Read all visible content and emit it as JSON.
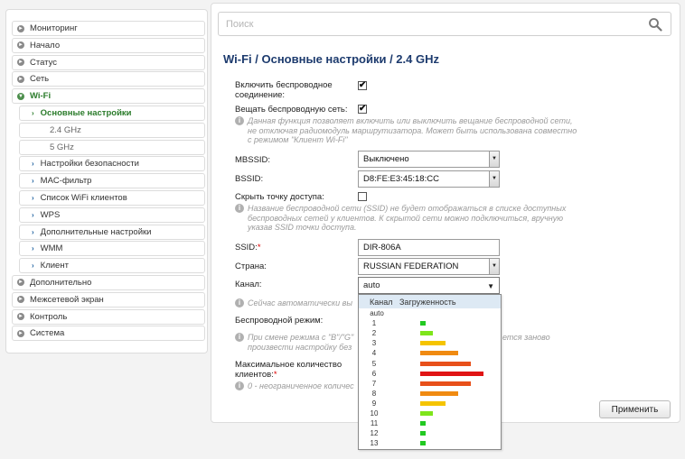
{
  "sidebar": {
    "items": [
      {
        "label": "Мониторинг",
        "kind": "top"
      },
      {
        "label": "Начало",
        "kind": "top"
      },
      {
        "label": "Статус",
        "kind": "top"
      },
      {
        "label": "Сеть",
        "kind": "top"
      },
      {
        "label": "Wi-Fi",
        "kind": "open"
      },
      {
        "label": "Основные настройки",
        "kind": "sub-active"
      },
      {
        "label": "2.4 GHz",
        "kind": "subsub"
      },
      {
        "label": "5 GHz",
        "kind": "subsub"
      },
      {
        "label": "Настройки безопасности",
        "kind": "sub"
      },
      {
        "label": "MAC-фильтр",
        "kind": "sub"
      },
      {
        "label": "Список WiFi клиентов",
        "kind": "sub"
      },
      {
        "label": "WPS",
        "kind": "sub"
      },
      {
        "label": "Дополнительные настройки",
        "kind": "sub"
      },
      {
        "label": "WMM",
        "kind": "sub"
      },
      {
        "label": "Клиент",
        "kind": "sub"
      },
      {
        "label": "Дополнительно",
        "kind": "top"
      },
      {
        "label": "Межсетевой экран",
        "kind": "top"
      },
      {
        "label": "Контроль",
        "kind": "top"
      },
      {
        "label": "Система",
        "kind": "top"
      }
    ]
  },
  "search": {
    "placeholder": "Поиск"
  },
  "page": {
    "title": "Wi-Fi /  Основные настройки /  2.4 GHz"
  },
  "form": {
    "enable_label": "Включить беспроводное соединение:",
    "enable_checked": true,
    "broadcast_label": "Вещать беспроводную сеть:",
    "broadcast_checked": true,
    "broadcast_hint": "Данная функция позволяет включить или выключить вещание беспроводной сети, не отключая радиомодуль маршрутизатора. Может быть использована совместно с режимом \"Клиент Wi-Fi\"",
    "mbssid_label": "MBSSID:",
    "mbssid_value": "Выключено",
    "bssid_label": "BSSID:",
    "bssid_value": "D8:FE:E3:45:18:CC",
    "hide_label": "Скрыть точку доступа:",
    "hide_checked": false,
    "hide_hint": "Название беспроводной сети (SSID) не будет отображаться в списке доступных беспроводных сетей у клиентов. К скрытой сети можно подключиться, вручную указав SSID точки доступа.",
    "ssid_label": "SSID:",
    "ssid_required": "*",
    "ssid_value": "DIR-806A",
    "country_label": "Страна:",
    "country_value": "RUSSIAN FEDERATION",
    "channel_label": "Канал:",
    "channel_value": "auto",
    "channel_hint": "Сейчас автоматически вы",
    "mode_label": "Беспроводной режим:",
    "mode_hint_left": "При смене режима с \"B\"/\"G\"",
    "mode_hint_left2": "произвести настройку без",
    "mode_hint_right": "ется заново",
    "max_clients_label": "Максимальное количество клиентов:",
    "max_clients_required": "*",
    "max_clients_hint": "0 - неограниченное количес",
    "apply_label": "Применить"
  },
  "channel_dropdown": {
    "col_channel": "Канал",
    "col_load": "Загруженность",
    "rows": [
      {
        "channel": "auto",
        "load": 0,
        "color": ""
      },
      {
        "channel": "1",
        "load": 0.08,
        "color": "#22c922"
      },
      {
        "channel": "2",
        "load": 0.2,
        "color": "#7ee51b"
      },
      {
        "channel": "3",
        "load": 0.4,
        "color": "#f5c400"
      },
      {
        "channel": "4",
        "load": 0.6,
        "color": "#f08a11"
      },
      {
        "channel": "5",
        "load": 0.8,
        "color": "#e8501a"
      },
      {
        "channel": "6",
        "load": 1.0,
        "color": "#e01414"
      },
      {
        "channel": "7",
        "load": 0.8,
        "color": "#e8501a"
      },
      {
        "channel": "8",
        "load": 0.6,
        "color": "#f08a11"
      },
      {
        "channel": "9",
        "load": 0.4,
        "color": "#f5c400"
      },
      {
        "channel": "10",
        "load": 0.2,
        "color": "#7ee51b"
      },
      {
        "channel": "11",
        "load": 0.08,
        "color": "#22c922"
      },
      {
        "channel": "12",
        "load": 0.08,
        "color": "#22c922"
      },
      {
        "channel": "13",
        "load": 0.08,
        "color": "#22c922"
      }
    ]
  }
}
